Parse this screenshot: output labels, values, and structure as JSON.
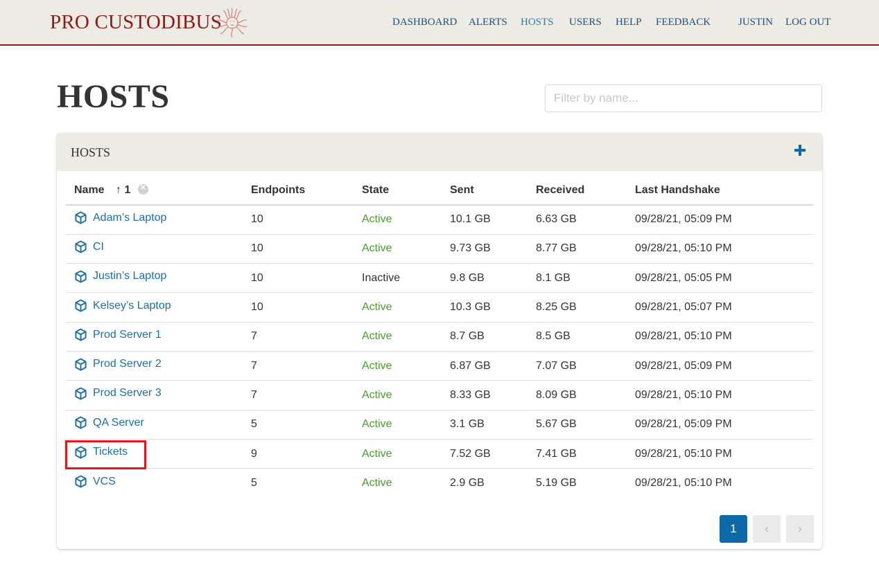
{
  "header": {
    "brand": "PRO CUSTODIBUS",
    "nav": [
      {
        "label": "DASHBOARD",
        "active": false
      },
      {
        "label": "ALERTS",
        "active": false
      },
      {
        "label": "HOSTS",
        "active": true
      },
      {
        "label": "USERS",
        "active": false
      },
      {
        "label": "HELP",
        "active": false
      },
      {
        "label": "FEEDBACK",
        "active": false
      }
    ],
    "user": "JUSTIN",
    "logout": "LOG OUT"
  },
  "page": {
    "title": "HOSTS",
    "filter_placeholder": "Filter by name...",
    "filter_value": ""
  },
  "card": {
    "title": "HOSTS",
    "add_icon": "plus-icon"
  },
  "table": {
    "columns": [
      "Name",
      "Endpoints",
      "State",
      "Sent",
      "Received",
      "Last Handshake"
    ],
    "sort": {
      "arrow": "↑",
      "order": "1",
      "clear_icon": "close-circle-icon"
    },
    "rows": [
      {
        "name": "Adam’s Laptop",
        "endpoints": "10",
        "state": "Active",
        "sent": "10.1 GB",
        "received": "6.63 GB",
        "last_handshake": "09/28/21, 05:09 PM"
      },
      {
        "name": "CI",
        "endpoints": "10",
        "state": "Active",
        "sent": "9.73 GB",
        "received": "8.77 GB",
        "last_handshake": "09/28/21, 05:10 PM"
      },
      {
        "name": "Justin’s Laptop",
        "endpoints": "10",
        "state": "Inactive",
        "sent": "9.8 GB",
        "received": "8.1 GB",
        "last_handshake": "09/28/21, 05:05 PM"
      },
      {
        "name": "Kelsey’s Laptop",
        "endpoints": "10",
        "state": "Active",
        "sent": "10.3 GB",
        "received": "8.25 GB",
        "last_handshake": "09/28/21, 05:07 PM"
      },
      {
        "name": "Prod Server 1",
        "endpoints": "7",
        "state": "Active",
        "sent": "8.7 GB",
        "received": "8.5 GB",
        "last_handshake": "09/28/21, 05:10 PM"
      },
      {
        "name": "Prod Server 2",
        "endpoints": "7",
        "state": "Active",
        "sent": "6.87 GB",
        "received": "7.07 GB",
        "last_handshake": "09/28/21, 05:09 PM"
      },
      {
        "name": "Prod Server 3",
        "endpoints": "7",
        "state": "Active",
        "sent": "8.33 GB",
        "received": "8.09 GB",
        "last_handshake": "09/28/21, 05:10 PM"
      },
      {
        "name": "QA Server",
        "endpoints": "5",
        "state": "Active",
        "sent": "3.1 GB",
        "received": "5.67 GB",
        "last_handshake": "09/28/21, 05:09 PM"
      },
      {
        "name": "Tickets",
        "endpoints": "9",
        "state": "Active",
        "sent": "7.52 GB",
        "received": "7.41 GB",
        "last_handshake": "09/28/21, 05:10 PM",
        "highlighted": true
      },
      {
        "name": "VCS",
        "endpoints": "5",
        "state": "Active",
        "sent": "2.9 GB",
        "received": "5.19 GB",
        "last_handshake": "09/28/21, 05:10 PM"
      }
    ]
  },
  "pagination": {
    "current": "1",
    "prev": "‹",
    "next": "›"
  },
  "colors": {
    "brand": "#8b1a1a",
    "nav": "#1e4d7b",
    "nav_active": "#2a7ab0",
    "link": "#1a6fa3",
    "active_state": "#4a9a2a",
    "primary": "#0d6aa8",
    "highlight": "#e8141a"
  }
}
